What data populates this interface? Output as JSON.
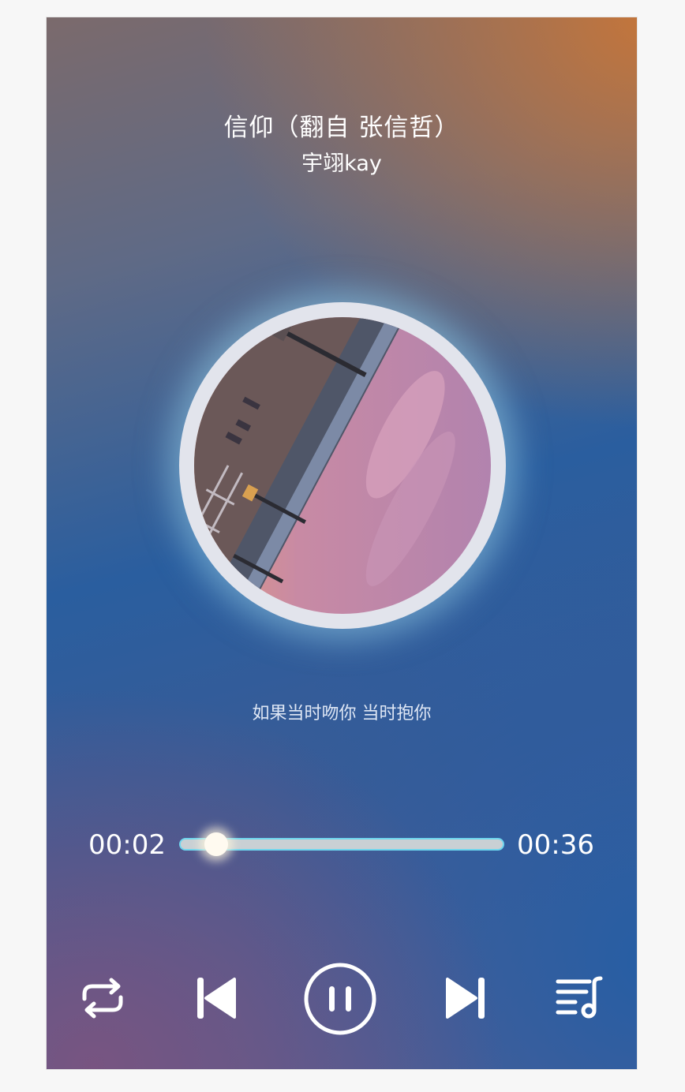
{
  "song": {
    "title": "信仰（翻自 张信哲）",
    "artist": "宇翊kay"
  },
  "lyrics": {
    "current_line": "如果当时吻你 当时抱你"
  },
  "playback": {
    "current_time": "00:02",
    "total_time": "00:36",
    "progress_fraction": 0.11,
    "is_playing": true
  },
  "controls": {
    "repeat_icon": "repeat-icon",
    "previous_icon": "skip-previous-icon",
    "pause_icon": "pause-icon",
    "next_icon": "skip-next-icon",
    "playlist_icon": "playlist-icon"
  },
  "colors": {
    "text": "#ffffff",
    "lyric": "#dfe7f5",
    "progress_track": "#c9d0d4",
    "progress_outline": "#6fd6ee",
    "thumb": "#fffaf0",
    "disc_ring": "#e2e4ec"
  }
}
